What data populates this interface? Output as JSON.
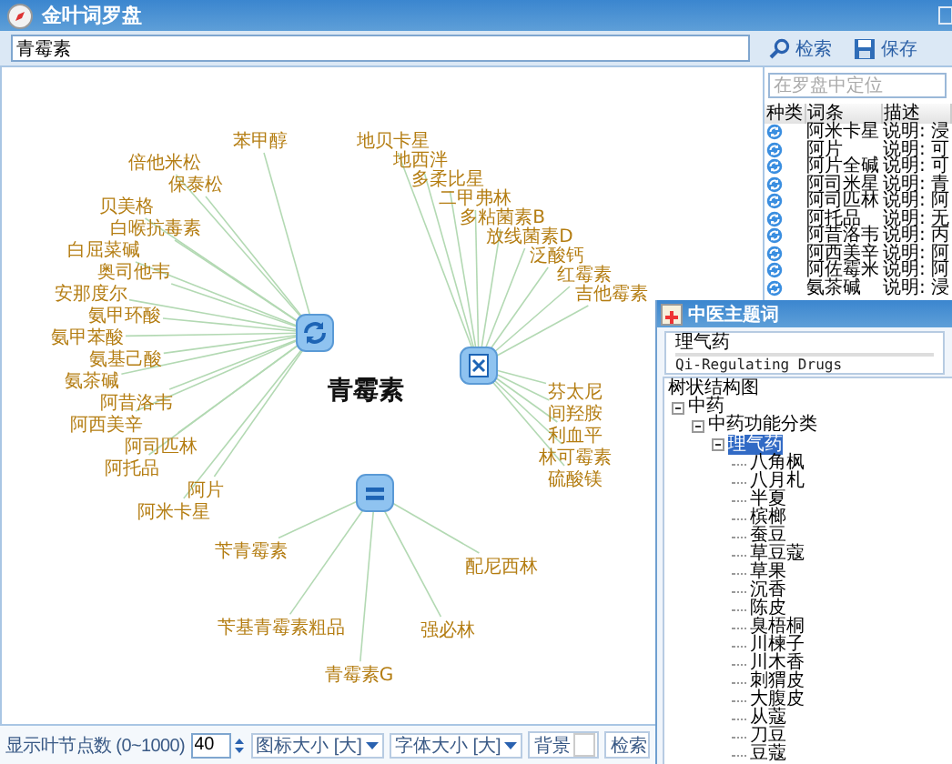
{
  "window": {
    "title": "金叶词罗盘"
  },
  "search": {
    "value": "青霉素",
    "buttons": [
      {
        "label": "检索",
        "kind": "search"
      },
      {
        "label": "保存",
        "kind": "save"
      }
    ]
  },
  "graph": {
    "center": "青霉素",
    "hubs": [
      {
        "kind": "refresh",
        "leaves": [
          "苯甲醇",
          "倍他米松",
          "保泰松",
          "贝美格",
          "白喉抗毒素",
          "白屈菜碱",
          "奥司他韦",
          "安那度尔",
          "氨甲环酸",
          "氨甲苯酸",
          "氨基己酸",
          "氨茶碱",
          "阿昔洛韦",
          "阿西美辛",
          "阿司匹林",
          "阿托品",
          "阿片",
          "阿米卡星"
        ]
      },
      {
        "kind": "document",
        "leaves": [
          "地贝卡星",
          "地西泮",
          "多柔比星",
          "二甲弗林",
          "多粘菌素B",
          "放线菌素D",
          "泛酸钙",
          "红霉素",
          "吉他霉素",
          "芬太尼",
          "间羟胺",
          "利血平",
          "林可霉素",
          "硫酸镁"
        ]
      },
      {
        "kind": "list",
        "leaves": [
          "苄青霉素",
          "苄基青霉素粗品",
          "青霉素G",
          "强必林",
          "配尼西林"
        ]
      }
    ]
  },
  "locate_field": {
    "placeholder": "在罗盘中定位"
  },
  "table": {
    "columns": [
      "种类",
      "词条",
      "描述"
    ],
    "rows": [
      {
        "term": "阿米卡星",
        "description": "说明: 浸"
      },
      {
        "term": "阿片",
        "description": "说明: 可"
      },
      {
        "term": "阿片全碱",
        "description": "说明: 可"
      },
      {
        "term": "阿司米星",
        "description": "说明: 青"
      },
      {
        "term": "阿司匹林",
        "description": "说明: 阿"
      },
      {
        "term": "阿托品",
        "description": "说明: 无"
      },
      {
        "term": "阿昔洛韦",
        "description": "说明: 丙"
      },
      {
        "term": "阿西美辛",
        "description": "说明: 阿"
      },
      {
        "term": "阿佐霉米",
        "description": "说明: 阿"
      },
      {
        "term": "氨茶碱",
        "description": "说明: 浸"
      }
    ]
  },
  "controls": {
    "leaf_count_label": "显示叶节点数 (0~1000)",
    "leaf_count": "40",
    "icon_size": "图标大小 [大]",
    "font_size": "字体大小 [大]",
    "background_button": "背景",
    "search_terms_button": "检索"
  },
  "popup": {
    "title": "中医主题词",
    "term": "理气药",
    "english": "Qi-Regulating Drugs",
    "tree_title": "树状结构图",
    "tree": [
      {
        "label": "中药",
        "expanded": true,
        "selected": false,
        "children": [
          {
            "label": "中药功能分类",
            "expanded": true,
            "selected": false,
            "children": [
              {
                "label": "理气药",
                "expanded": true,
                "selected": true,
                "children": [
                  {
                    "label": "八角枫",
                    "selected": false
                  },
                  {
                    "label": "八月札",
                    "selected": false
                  },
                  {
                    "label": "半夏",
                    "selected": false
                  },
                  {
                    "label": "槟榔",
                    "selected": false
                  },
                  {
                    "label": "蚕豆",
                    "selected": false
                  },
                  {
                    "label": "草豆蔻",
                    "selected": false
                  },
                  {
                    "label": "草果",
                    "selected": false
                  },
                  {
                    "label": "沉香",
                    "selected": false
                  },
                  {
                    "label": "陈皮",
                    "selected": false
                  },
                  {
                    "label": "臭梧桐",
                    "selected": false
                  },
                  {
                    "label": "川楝子",
                    "selected": false
                  },
                  {
                    "label": "川木香",
                    "selected": false
                  },
                  {
                    "label": "刺猬皮",
                    "selected": false
                  },
                  {
                    "label": "大腹皮",
                    "selected": false
                  },
                  {
                    "label": "从蔻",
                    "selected": false
                  },
                  {
                    "label": "刀豆",
                    "selected": false
                  },
                  {
                    "label": "豆蔻",
                    "selected": false
                  }
                ]
              }
            ]
          }
        ]
      }
    ]
  }
}
